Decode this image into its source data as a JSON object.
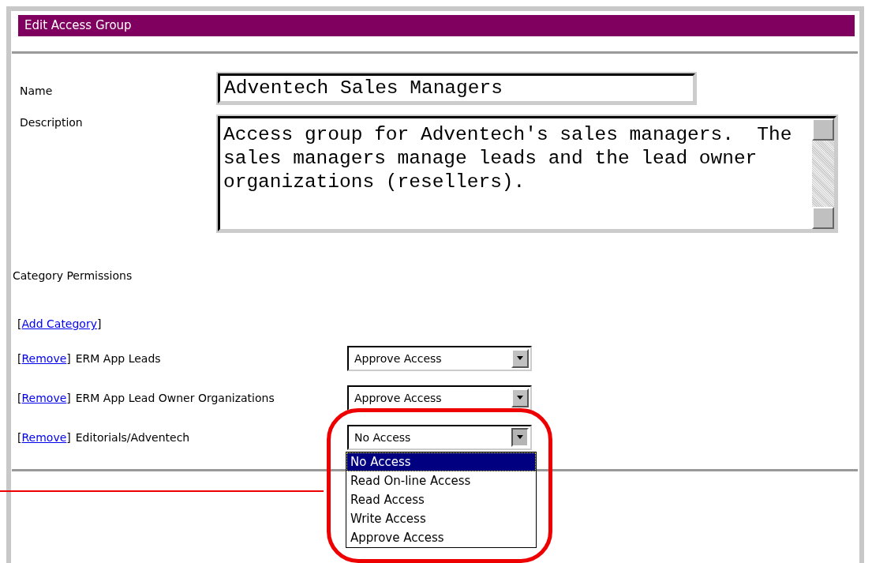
{
  "header": {
    "title": "Edit Access Group"
  },
  "fields": [
    {
      "kind": "input",
      "label": "Name",
      "value": "Adventech Sales Managers"
    },
    {
      "kind": "textarea",
      "label": "Description",
      "value": "Access group for Adventech's sales managers.  The sales managers manage leads and the lead owner organizations (resellers)."
    }
  ],
  "section_title": "Category Permissions",
  "add_link": {
    "open": "[",
    "label": "Add Category",
    "close": "]"
  },
  "categories": [
    {
      "open": "[",
      "remove_link": "Remove",
      "close": "]",
      "name": "ERM App Leads",
      "value": "Approve Access",
      "expanded": false
    },
    {
      "open": "[",
      "remove_link": "Remove",
      "close": "]",
      "name": "ERM App Lead Owner Organizations",
      "value": "Approve Access",
      "expanded": false
    },
    {
      "open": "[",
      "remove_link": "Remove",
      "close": "]",
      "name": "Editorials/Adventech",
      "value": "No Access",
      "expanded": true
    }
  ],
  "dropdown_options": [
    {
      "label": "No Access",
      "selected": true
    },
    {
      "label": "Read On-line Access",
      "selected": false
    },
    {
      "label": "Read Access",
      "selected": false
    },
    {
      "label": "Write Access",
      "selected": false
    },
    {
      "label": "Approve Access",
      "selected": false
    }
  ]
}
